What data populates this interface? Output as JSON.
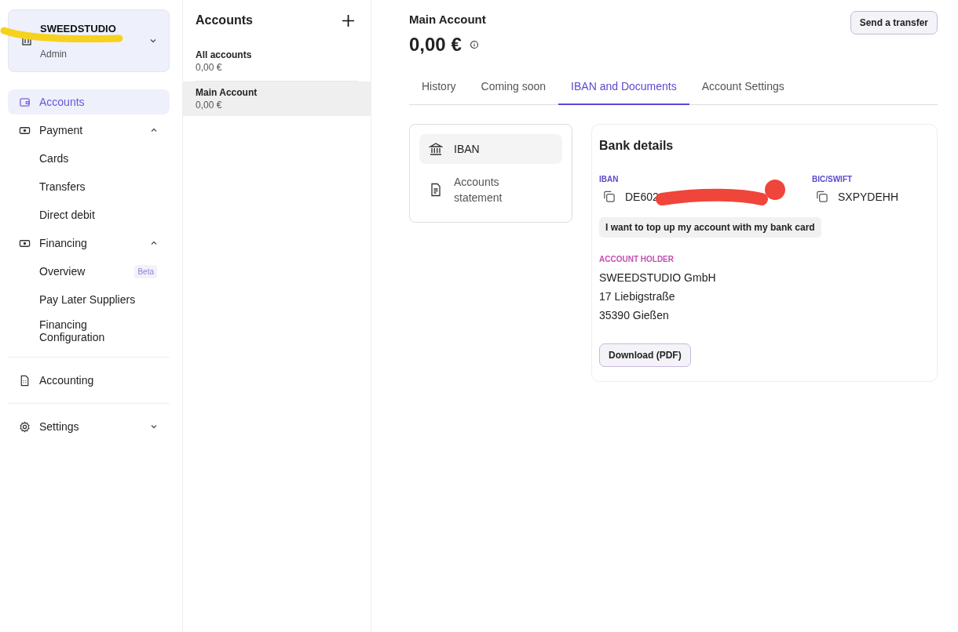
{
  "workspace": {
    "name": "SWEEDSTUDIO",
    "role": "Admin"
  },
  "nav_sections": [
    [
      {
        "label": "Accounts",
        "selected": true
      },
      {
        "label": "Payment",
        "selected": false,
        "expanded": true,
        "children": [
          {
            "label": "Cards",
            "selected": false
          },
          {
            "label": "Transfers",
            "selected": false
          },
          {
            "label": "Direct debit",
            "selected": false
          }
        ]
      },
      {
        "label": "Financing",
        "selected": false,
        "expanded": true,
        "children": [
          {
            "label": "Overview",
            "selected": false,
            "badge": "Beta"
          },
          {
            "label": "Pay Later Suppliers",
            "selected": false
          },
          {
            "label": "Financing Configuration",
            "selected": false
          }
        ]
      }
    ],
    [
      {
        "label": "Accounting",
        "selected": false
      }
    ],
    [
      {
        "label": "Settings",
        "selected": false,
        "expanded": false
      }
    ]
  ],
  "accounts_panel": {
    "title": "Accounts",
    "items": [
      {
        "name": "All accounts",
        "amount": "0,00 €",
        "selected": false
      },
      {
        "name": "Main Account",
        "amount": "0,00 €",
        "selected": true
      }
    ]
  },
  "account": {
    "title": "Main Account",
    "balance": "0,00 €",
    "action": "Send a transfer"
  },
  "tabs": [
    {
      "label": "History",
      "selected": false
    },
    {
      "label": "Coming soon",
      "selected": false
    },
    {
      "label": "IBAN and Documents",
      "selected": true
    },
    {
      "label": "Account Settings",
      "selected": false
    }
  ],
  "doc_menu": [
    {
      "label": "IBAN",
      "selected": true
    },
    {
      "label": "Accounts statement",
      "selected": false
    }
  ],
  "bank_details": {
    "title": "Bank details",
    "iban_label": "IBAN",
    "iban": "DE602",
    "bic_label": "BIC/SWIFT",
    "bic": "SXPYDEHH",
    "top_up": "I want to top up my account with my bank card",
    "holder_label": "ACCOUNT HOLDER",
    "holder_lines": [
      "SWEEDSTUDIO GmbH",
      "17 Liebigstraße",
      "35390 Gießen"
    ],
    "download": "Download (PDF)"
  }
}
